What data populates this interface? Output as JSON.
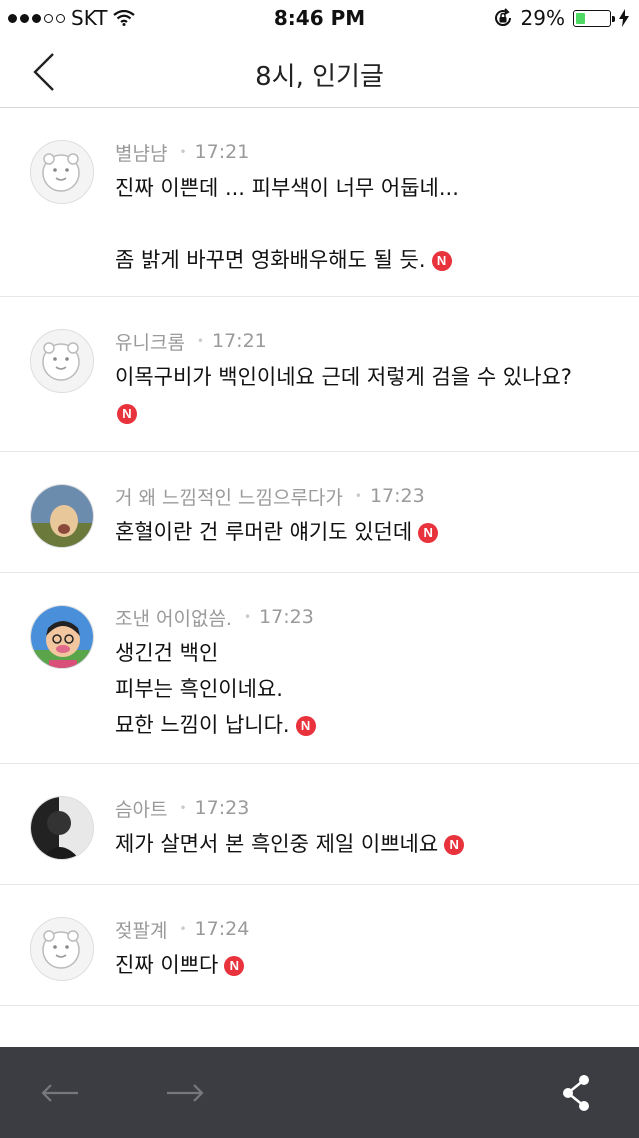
{
  "status": {
    "carrier": "SKT",
    "time": "8:46 PM",
    "battery": "29%",
    "battery_level": 0.29
  },
  "header": {
    "title": "8시, 인기글"
  },
  "comments": [
    {
      "author": "별냠냠",
      "time": "17:21",
      "lines": [
        "진짜 이쁜데 ... 피부색이 너무 어둡네...",
        "",
        "좀 밝게 바꾸면 영화배우해도 될 듯."
      ],
      "badge": "N",
      "avatar_icon": "character-avatar-icon"
    },
    {
      "author": "유니크롬",
      "time": "17:21",
      "lines": [
        "이목구비가 백인이네요 근데 저렇게 검을 수 있나요?"
      ],
      "badge": "N",
      "avatar_icon": "character-avatar-icon"
    },
    {
      "author": "거 왜 느낌적인 느낌으루다가",
      "time": "17:23",
      "lines": [
        "혼혈이란 건 루머란 얘기도 있던데"
      ],
      "badge": "N",
      "avatar_icon": "photo-avatar-icon"
    },
    {
      "author": "조낸 어이없씀.",
      "time": "17:23",
      "lines": [
        "생긴건 백인",
        "피부는 흑인이네요.",
        "묘한 느낌이 납니다."
      ],
      "badge": "N",
      "avatar_icon": "cartoon-avatar-icon"
    },
    {
      "author": "슴아트",
      "time": "17:23",
      "lines": [
        "제가 살면서 본 흑인중 제일 이쁘네요"
      ],
      "badge": "N",
      "avatar_icon": "photo-avatar-icon"
    },
    {
      "author": "젖팔계",
      "time": "17:24",
      "lines": [
        "진짜 이쁘다"
      ],
      "badge": "N",
      "avatar_icon": "character-avatar-icon"
    }
  ],
  "toolbar": {
    "back_icon": "arrow-left-icon",
    "forward_icon": "arrow-right-icon",
    "share_icon": "share-icon"
  },
  "colors": {
    "badge": "#e8323c",
    "toolbar": "#3b3d42",
    "battery": "#4cd964"
  }
}
